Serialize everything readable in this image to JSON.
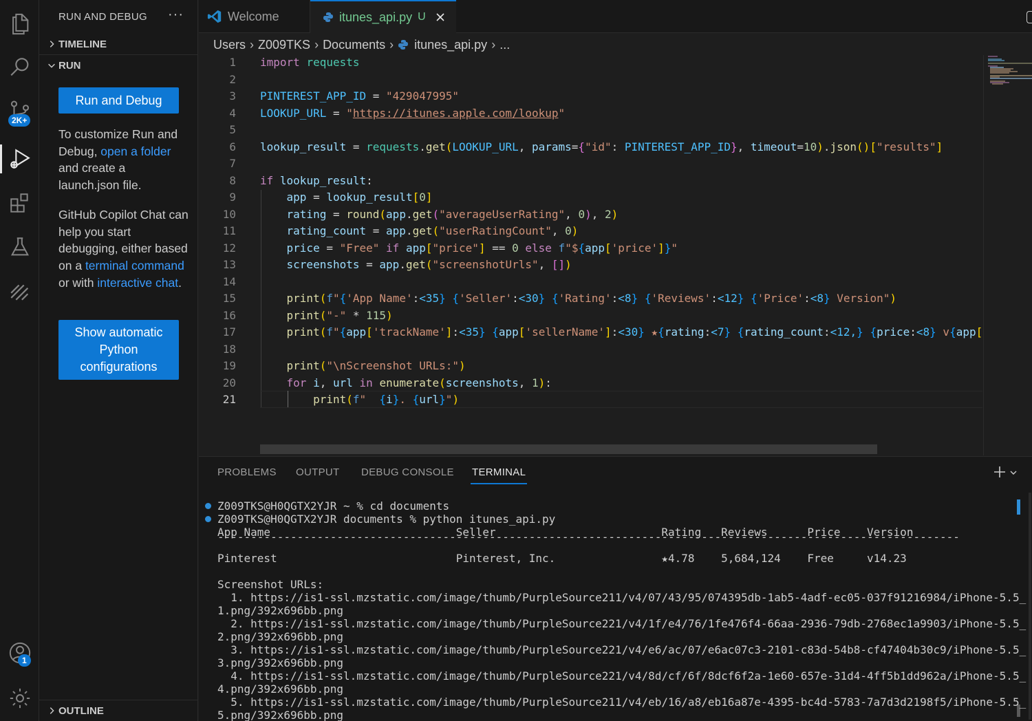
{
  "sidebar": {
    "title": "RUN AND DEBUG",
    "more": "···",
    "timeline": "TIMELINE",
    "run": "RUN",
    "run_debug_button": "Run and Debug",
    "customize_1": "To customize Run and Debug, ",
    "customize_link": "open a folder",
    "customize_2": " and create a launch.json file.",
    "copilot_1": "GitHub Copilot Chat can help you start debugging, either based on a ",
    "copilot_link1": "terminal command",
    "copilot_2": " or with ",
    "copilot_link2": "interactive chat",
    "copilot_3": ".",
    "python_button": "Show automatic Python configurations",
    "outline": "OUTLINE"
  },
  "activity": {
    "scm_badge": "2K+",
    "account_badge": "1"
  },
  "tabs": [
    {
      "label": "Welcome",
      "icon": "vscode-logo-icon"
    },
    {
      "label": "itunes_api.py",
      "status": "U",
      "icon": "python-icon"
    }
  ],
  "breadcrumb": [
    "Users",
    "Z009TKS",
    "Documents",
    "itunes_api.py",
    "..."
  ],
  "editor": {
    "line_numbers": [
      "1",
      "2",
      "3",
      "4",
      "5",
      "6",
      "7",
      "8",
      "9",
      "10",
      "11",
      "12",
      "13",
      "14",
      "15",
      "16",
      "17",
      "18",
      "19",
      "20",
      "21"
    ],
    "current_line": "21"
  },
  "panel": {
    "tabs": [
      "PROBLEMS",
      "OUTPUT",
      "DEBUG CONSOLE",
      "TERMINAL"
    ],
    "active_tab": "TERMINAL",
    "terminal_lines": [
      "Z009TKS@H0QGTX2YJR ~ % cd documents",
      "Z009TKS@H0QGTX2YJR documents % python itunes_api.py",
      "App Name                            Seller                         Rating   Reviews      Price    Version",
      "----------------------------------------------------------------------------------------------------------------",
      "Pinterest                           Pinterest, Inc.                ★4.78    5,684,124    Free     v14.23",
      "",
      "Screenshot URLs:",
      "  1. https://is1-ssl.mzstatic.com/image/thumb/PurpleSource211/v4/07/43/95/074395db-1ab5-4adf-ec05-037f91216984/iPhone-5.5_",
      "1.png/392x696bb.png",
      "  2. https://is1-ssl.mzstatic.com/image/thumb/PurpleSource221/v4/1f/e4/76/1fe476f4-66aa-2936-79db-2768ec1a9903/iPhone-5.5_",
      "2.png/392x696bb.png",
      "  3. https://is1-ssl.mzstatic.com/image/thumb/PurpleSource221/v4/e6/ac/07/e6ac07c3-2101-c83d-54b8-cf47404b30c9/iPhone-5.5_",
      "3.png/392x696bb.png",
      "  4. https://is1-ssl.mzstatic.com/image/thumb/PurpleSource221/v4/8d/cf/6f/8dcf6f2a-1e60-657e-31d4-4ff5b1dd962a/iPhone-5.5_",
      "4.png/392x696bb.png",
      "  5. https://is1-ssl.mzstatic.com/image/thumb/PurpleSource211/v4/eb/16/a8/eb16a87e-4395-bc4d-5783-7a7d3d2198f5/iPhone-5.5_",
      "5.png/392x696bb.png"
    ]
  }
}
